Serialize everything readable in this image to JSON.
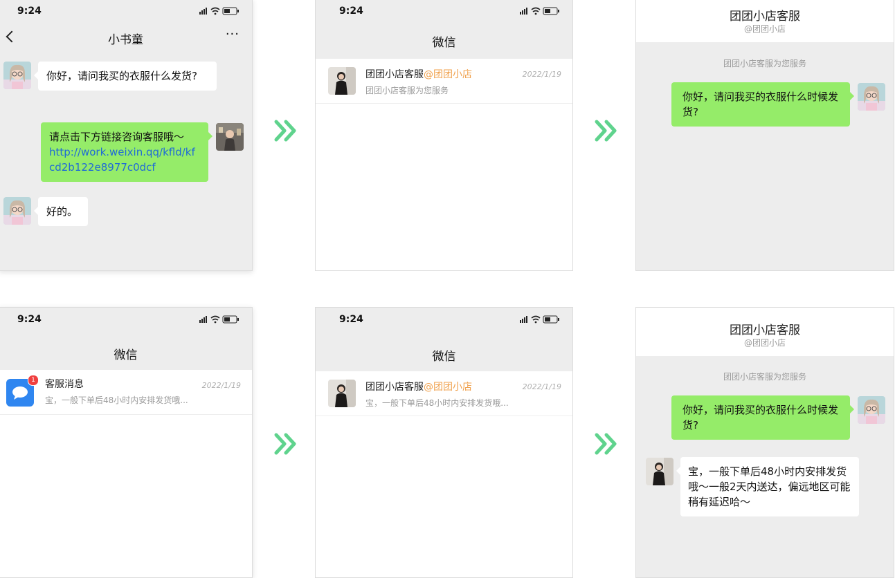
{
  "status_time": "9:24",
  "panel1": {
    "title": "小书童",
    "more": "···",
    "msg1": "你好，请问我买的衣服什么发货?",
    "msg2_text": "请点击下方链接咨询客服哦～",
    "msg2_link": "http://work.weixin.qq/kfld/kfcd2b122e8977c0dcf",
    "msg3": "好的。"
  },
  "panel2": {
    "title": "微信",
    "row_name": "团团小店客服",
    "row_org": "@团团小店",
    "row_date": "2022/1/19",
    "row_preview": "团团小店客服为您服务"
  },
  "panel3": {
    "title": "团团小店客服",
    "sub": "@团团小店",
    "note": "团团小店客服为您服务",
    "msg": "你好，请问我买的衣服什么时候发货?"
  },
  "panel4": {
    "title": "微信",
    "row_name": "客服消息",
    "row_date": "2022/1/19",
    "row_preview": "宝，一般下单后48小时内安排发货哦...",
    "badge": "1"
  },
  "panel5": {
    "title": "微信",
    "row_name": "团团小店客服",
    "row_org": "@团团小店",
    "row_date": "2022/1/19",
    "row_preview": "宝，一般下单后48小时内安排发货哦..."
  },
  "panel6": {
    "title": "团团小店客服",
    "sub": "@团团小店",
    "note": "团团小店客服为您服务",
    "msg1": "你好，请问我买的衣服什么时候发货?",
    "msg2": "宝，一般下单后48小时内安排发货哦～一般2天内送达，偏远地区可能稍有延迟哈～"
  },
  "colors": {
    "bubble_green": "#95ec69",
    "arrow_green": "#5fd38d",
    "org_orange": "#f0a04b",
    "link_blue": "#1f6bd6",
    "badge_red": "#f04040"
  },
  "icons": [
    "signal-icon",
    "wifi-icon",
    "battery-icon",
    "back-icon",
    "more-icon",
    "double-chevron-icon",
    "message-bubble-icon"
  ]
}
